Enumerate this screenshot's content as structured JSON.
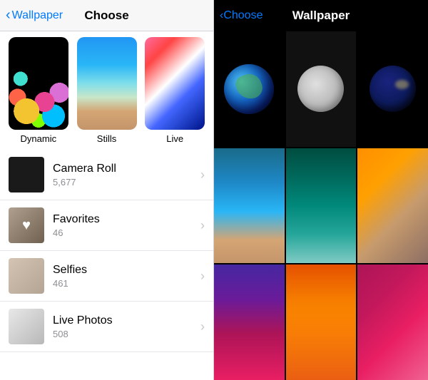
{
  "left_panel": {
    "nav": {
      "back_label": "Wallpaper",
      "title": "Choose"
    },
    "categories": [
      {
        "id": "dynamic",
        "label": "Dynamic"
      },
      {
        "id": "stills",
        "label": "Stills"
      },
      {
        "id": "live",
        "label": "Live"
      }
    ],
    "library_items": [
      {
        "id": "camera_roll",
        "name": "Camera Roll",
        "count": "5,677"
      },
      {
        "id": "favorites",
        "name": "Favorites",
        "count": "46"
      },
      {
        "id": "selfies",
        "name": "Selfies",
        "count": "461"
      },
      {
        "id": "live_photos",
        "name": "Live Photos",
        "count": "508"
      }
    ]
  },
  "right_panel": {
    "nav": {
      "back_label": "Choose",
      "title": "Wallpaper"
    },
    "grid_items": [
      "earth",
      "moon",
      "earth-night",
      "wave",
      "teal",
      "abstract",
      "purple",
      "flowers",
      "pink"
    ]
  }
}
